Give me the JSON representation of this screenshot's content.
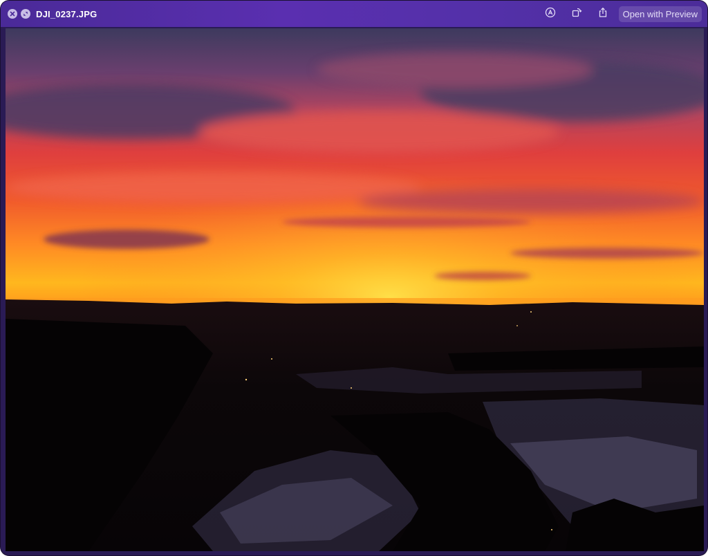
{
  "window": {
    "title": "DJI_0237.JPG",
    "close_icon": "close-icon",
    "fullscreen_icon": "fullscreen-icon"
  },
  "toolbar": {
    "markup_icon": "markup-icon",
    "rotate_icon": "rotate-icon",
    "share_icon": "share-icon",
    "open_with_label": "Open with Preview"
  },
  "colors": {
    "titlebar": "#5330a8",
    "sky_top": "#4a4468",
    "sky_mid": "#e84a3a",
    "horizon": "#ffb81e",
    "ground": "#0a0608"
  }
}
